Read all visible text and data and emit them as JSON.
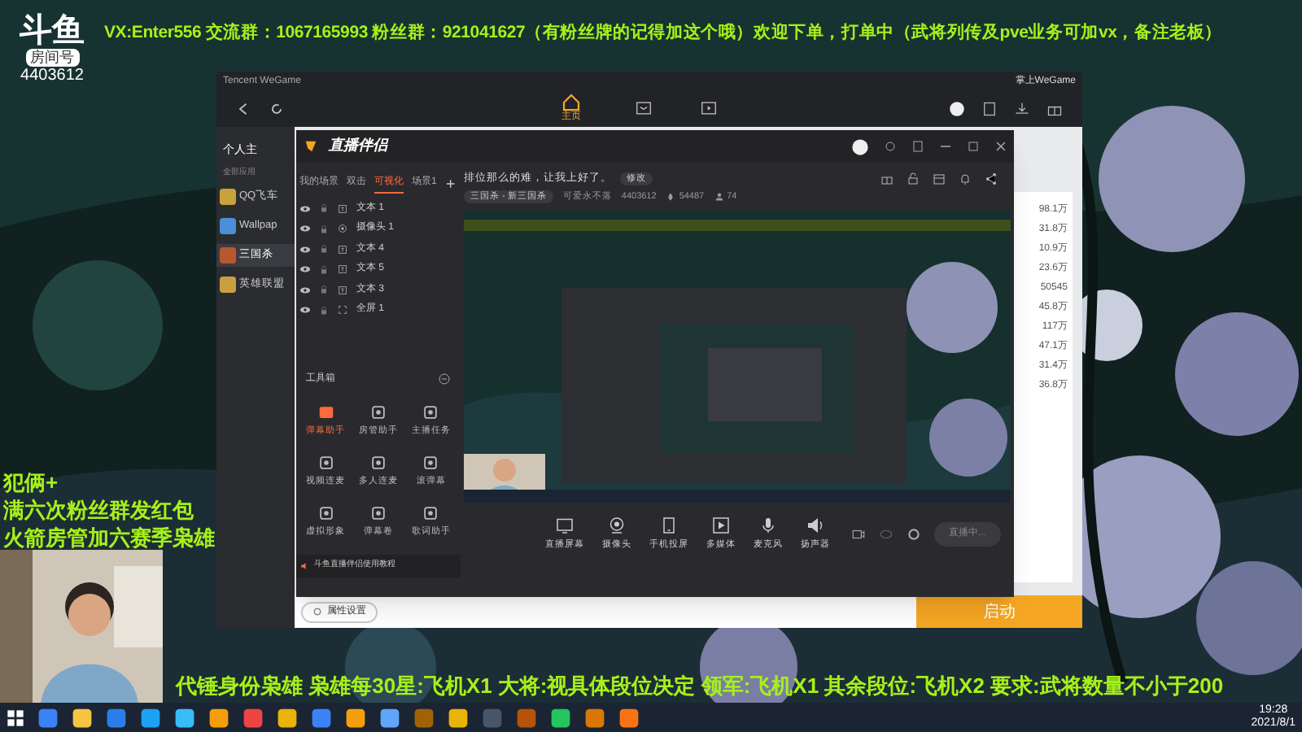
{
  "stream_overlay": {
    "platform_logo": "斗鱼",
    "room_label": "房间号",
    "room_id": "4403612",
    "banner_top": "VX:Enter556  交流群：1067165993 粉丝群：921041627（有粉丝牌的记得加这个哦）欢迎下单，打单中（武将列传及pve业务可加vx，备注老板）",
    "side_lines": [
      "犯俩+",
      "满六次粉丝群发红包",
      "火箭房管加六赛季枭雄"
    ],
    "banner_bottom": "代锤身份枭雄 枭雄每30星:飞机X1 大将:视具体段位决定 领军:飞机X1 其余段位:飞机X2 要求:武将数量不小于200"
  },
  "wegame": {
    "title": "Tencent WeGame",
    "home_label": "主页",
    "mobile_label": "掌上WeGame",
    "sidebar_title": "个人主",
    "apps_group": "全部应用",
    "apps": [
      {
        "label": "QQ飞车",
        "selected": false,
        "color": "#c9a23a"
      },
      {
        "label": "Wallpap",
        "selected": false,
        "color": "#4a8fd8"
      },
      {
        "label": "三国杀",
        "selected": true,
        "color": "#b8582e"
      },
      {
        "label": "英雄联盟",
        "selected": false,
        "color": "#c8a040"
      }
    ],
    "right_values": [
      "98.1万",
      "31.8万",
      "10.9万",
      "23.6万",
      "50545",
      "45.8万",
      "117万",
      "47.1万",
      "31.4万",
      "36.8万"
    ],
    "property_button": "属性设置",
    "start_button": "启动"
  },
  "companion": {
    "logo": "直播伴侣",
    "scene_tabs": [
      {
        "label": "我的场景",
        "selected": false
      },
      {
        "label": "双击",
        "selected": false
      },
      {
        "label": "可视化",
        "selected": true
      },
      {
        "label": "场景1",
        "selected": false
      }
    ],
    "sources": [
      {
        "label": "文本 1",
        "kind": "text"
      },
      {
        "label": "摄像头 1",
        "kind": "camera"
      },
      {
        "label": "文本 4",
        "kind": "text"
      },
      {
        "label": "文本 5",
        "kind": "text"
      },
      {
        "label": "文本 3",
        "kind": "text"
      },
      {
        "label": "全屏 1",
        "kind": "screen"
      }
    ],
    "toolbox_title": "工具箱",
    "tools": [
      {
        "label": "弹幕助手",
        "selected": true
      },
      {
        "label": "房管助手",
        "selected": false
      },
      {
        "label": "主播任务",
        "selected": false
      },
      {
        "label": "视频连麦",
        "selected": false
      },
      {
        "label": "多人连麦",
        "selected": false
      },
      {
        "label": "滚弹幕",
        "selected": false
      },
      {
        "label": "虚拟形象",
        "selected": false
      },
      {
        "label": "弹幕卷",
        "selected": false
      },
      {
        "label": "歌词助手",
        "selected": false
      }
    ],
    "notice": "斗鱼直播伴侣使用教程",
    "stream_title": "排位那么的难，让我上好了。",
    "edit_button": "修改",
    "category": "三国杀 - 新三国杀",
    "streamer": "可爱永不落",
    "room_id": "4403612",
    "heat": "54487",
    "viewers": "74",
    "controls": [
      {
        "label": "直播屏幕",
        "kind": "screen"
      },
      {
        "label": "摄像头",
        "kind": "camera"
      },
      {
        "label": "手机投屏",
        "kind": "phone"
      },
      {
        "label": "多媒体",
        "kind": "media"
      },
      {
        "label": "麦克风",
        "kind": "mic"
      },
      {
        "label": "扬声器",
        "kind": "speaker"
      }
    ],
    "live_button": "直播中..."
  },
  "taskbar": {
    "time": "19:28",
    "date": "2021/8/1"
  }
}
